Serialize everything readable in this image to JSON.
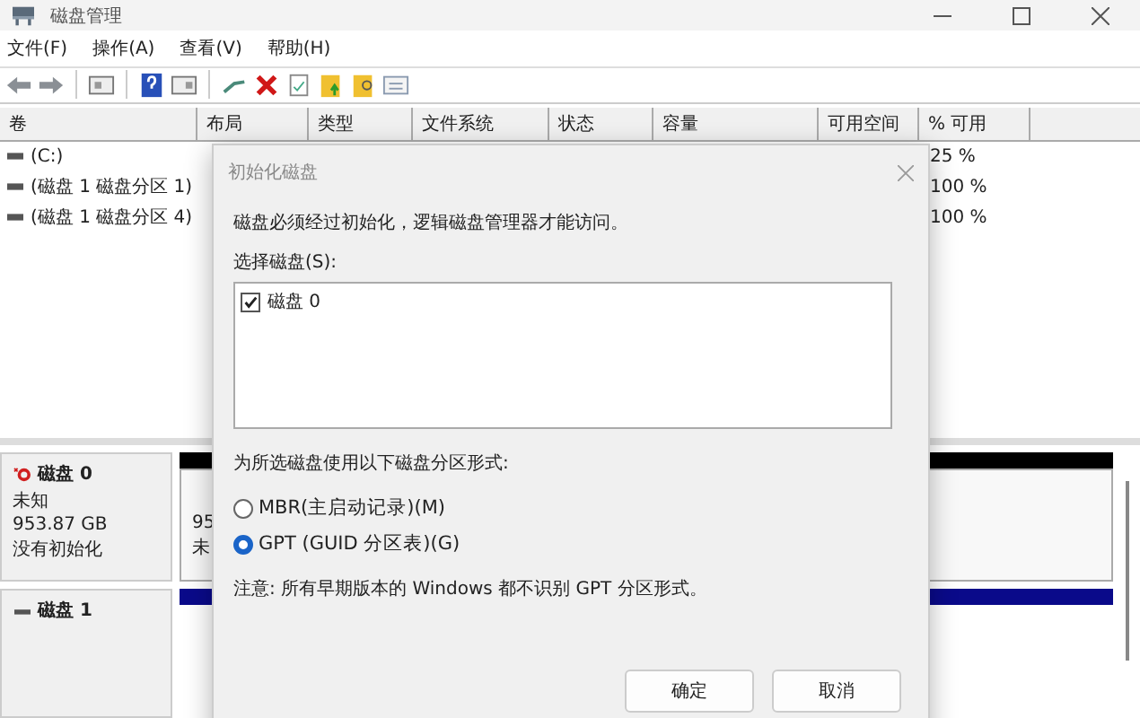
{
  "window": {
    "title": "磁盘管理"
  },
  "menu": [
    "文件(F)",
    "操作(A)",
    "查看(V)",
    "帮助(H)"
  ],
  "table": {
    "columns": [
      "卷",
      "布局",
      "类型",
      "文件系统",
      "状态",
      "容量",
      "可用空间",
      "% 可用"
    ],
    "rows": [
      {
        "volume": "(C:)",
        "percent_free": "25 %"
      },
      {
        "volume": "(磁盘 1 磁盘分区 1)",
        "percent_free": "100 %"
      },
      {
        "volume": "(磁盘 1 磁盘分区 4)",
        "percent_free": "100 %"
      }
    ]
  },
  "disks": [
    {
      "name": "磁盘 0",
      "kind": "uninitialized",
      "lines": [
        "未知",
        "953.87 GB",
        "没有初始化"
      ],
      "partition_lines": [
        "95",
        "未"
      ]
    },
    {
      "name": "磁盘 1",
      "kind": "basic"
    }
  ],
  "dialog": {
    "title": "初始化磁盘",
    "message": "磁盘必须经过初始化，逻辑磁盘管理器才能访问。",
    "select_label": "选择磁盘(S):",
    "disks": [
      {
        "label": "磁盘 0",
        "checked": true
      }
    ],
    "style_label": "为所选磁盘使用以下磁盘分区形式:",
    "options": [
      {
        "label": "MBR(主启动记录)(M)",
        "selected": false
      },
      {
        "label": "GPT (GUID 分区表)(G)",
        "selected": true
      }
    ],
    "note": "注意: 所有早期版本的 Windows 都不识别 GPT 分区形式。",
    "buttons": [
      "确定",
      "取消"
    ]
  }
}
